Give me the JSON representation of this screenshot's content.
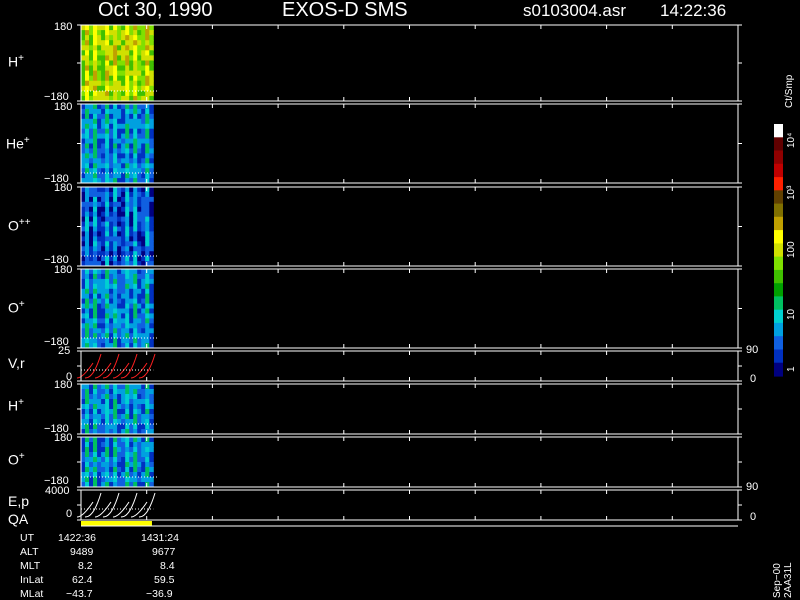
{
  "header": {
    "date": "Oct 30, 1990",
    "instrument": "EXOS-D SMS",
    "file": "s0103004.asr",
    "time": "14:22:36"
  },
  "colorbar": {
    "unit": "Ct/Smp",
    "ticks": [
      "1",
      "10",
      "100",
      "10³",
      "10⁴"
    ],
    "colors": [
      "#000080",
      "#0030c0",
      "#1060e0",
      "#00a0e0",
      "#00d0d0",
      "#00c060",
      "#00a000",
      "#40c000",
      "#80e000",
      "#d0e000",
      "#ffff00",
      "#c0a000",
      "#807000",
      "#604000",
      "#ff2000",
      "#c00000",
      "#900000",
      "#600000",
      "#ffffff"
    ]
  },
  "chart_data": [
    {
      "type": "heatmap",
      "panel": "H+",
      "label": "H",
      "charge": "+",
      "ylim": [
        -180,
        180
      ],
      "ticks": [
        "180",
        "−180"
      ],
      "x_data_fraction": [
        0,
        0.1
      ],
      "dominant_color": "#40c000"
    },
    {
      "type": "heatmap",
      "panel": "He+",
      "label": "He",
      "charge": "+",
      "ylim": [
        -180,
        180
      ],
      "ticks": [
        "180",
        "−180"
      ],
      "x_data_fraction": [
        0,
        0.1
      ],
      "dominant_color": "#1060e0"
    },
    {
      "type": "heatmap",
      "panel": "O++",
      "label": "O",
      "charge": "++",
      "ylim": [
        -180,
        180
      ],
      "ticks": [
        "180",
        "−180"
      ],
      "x_data_fraction": [
        0,
        0.1
      ],
      "dominant_color": "#0030c0"
    },
    {
      "type": "heatmap",
      "panel": "O+",
      "label": "O",
      "charge": "+",
      "ylim": [
        -180,
        180
      ],
      "ticks": [
        "180",
        "−180"
      ],
      "x_data_fraction": [
        0,
        0.1
      ],
      "dominant_color": "#1060e0"
    },
    {
      "type": "line",
      "panel": "V,r",
      "label": "V,r",
      "ylim": [
        0,
        25
      ],
      "ticks": [
        "25",
        "0"
      ],
      "right_ticks": [
        "90",
        "0"
      ],
      "series_color": "#ff2020"
    },
    {
      "type": "heatmap",
      "panel": "H+ (2)",
      "label": "H",
      "charge": "+",
      "ylim": [
        -180,
        180
      ],
      "ticks": [
        "180",
        "−180"
      ],
      "x_data_fraction": [
        0,
        0.1
      ],
      "dominant_color": "#1060e0"
    },
    {
      "type": "heatmap",
      "panel": "O+ (2)",
      "label": "O",
      "charge": "+",
      "ylim": [
        -180,
        180
      ],
      "ticks": [
        "180",
        "−180"
      ],
      "x_data_fraction": [
        0,
        0.1
      ],
      "dominant_color": "#1060e0"
    },
    {
      "type": "line",
      "panel": "E,p",
      "label": "E,p",
      "ylim": [
        0,
        4000
      ],
      "ticks": [
        "4000",
        "0"
      ],
      "right_ticks": [
        "90",
        "0"
      ],
      "series_color": "#ffffff"
    }
  ],
  "qa": {
    "label": "QA",
    "bar_color": "#ffff00"
  },
  "info_table": {
    "rows": [
      {
        "name": "UT",
        "v1": "1422:36",
        "v2": "1431:24"
      },
      {
        "name": "ALT",
        "v1": "9489",
        "v2": "9677"
      },
      {
        "name": "MLT",
        "v1": "8.2",
        "v2": "8.4"
      },
      {
        "name": "InLat",
        "v1": "62.4",
        "v2": "59.5"
      },
      {
        "name": "MLat",
        "v1": "−43.7",
        "v2": "−36.9"
      }
    ]
  },
  "footer_vertical": "Sep−00 2AA31L"
}
